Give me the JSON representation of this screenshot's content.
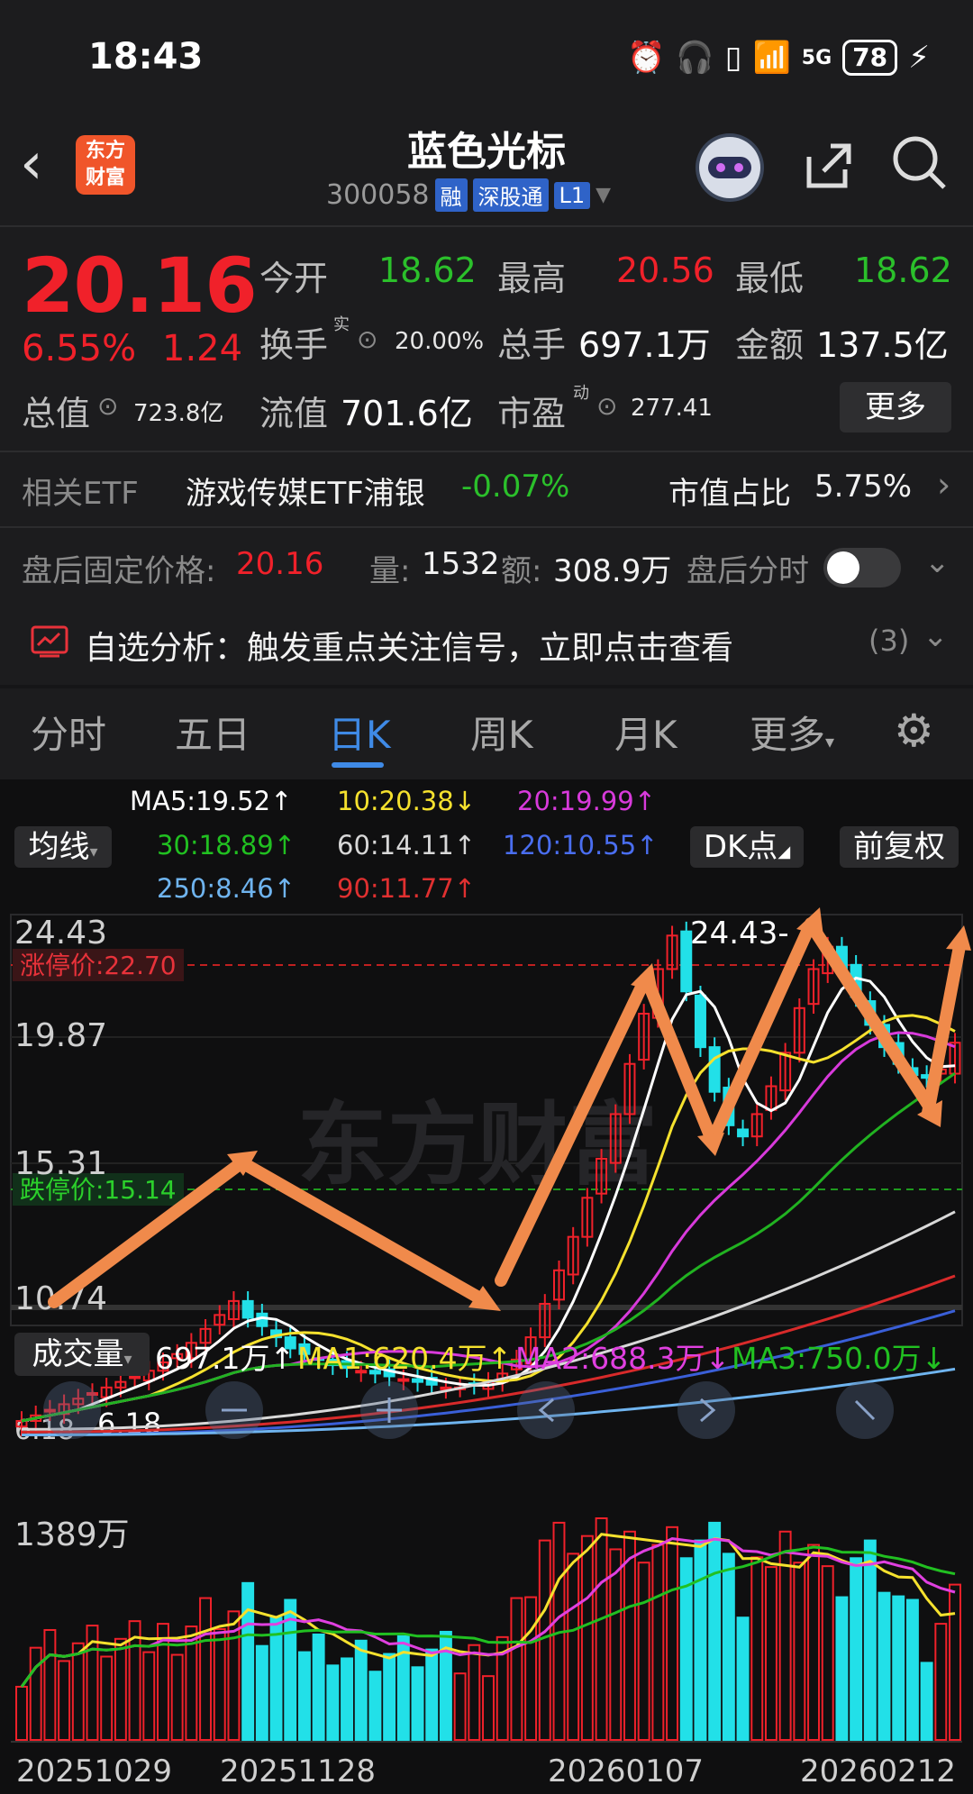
{
  "status_bar": {
    "time": "18:43",
    "network": "5G",
    "battery": "78"
  },
  "header": {
    "logo_text_1": "东方",
    "logo_text_2": "财富",
    "stock_name": "蓝色光标",
    "stock_code": "300058",
    "tags": [
      "融",
      "深股通",
      "L1"
    ]
  },
  "quote": {
    "price": "20.16",
    "change_pct": "6.55%",
    "change": "1.24",
    "open_label": "今开",
    "open": "18.62",
    "high_label": "最高",
    "high": "20.56",
    "low_label": "最低",
    "low": "18.62",
    "turnover_label": "换手",
    "turnover_sup": "实",
    "turnover": "20.00%",
    "volume_label": "总手",
    "volume": "697.1万",
    "amount_label": "金额",
    "amount": "137.5亿",
    "mktcap_label": "总值",
    "mktcap": "723.8亿",
    "float_label": "流值",
    "float_cap": "701.6亿",
    "pe_label": "市盈",
    "pe_sup": "动",
    "pe": "277.41",
    "more_button": "更多"
  },
  "etf": {
    "label": "相关ETF",
    "name": "游戏传媒ETF浦银",
    "change": "-0.07%",
    "weight_label": "市值占比",
    "weight": "5.75%"
  },
  "after_hours": {
    "label": "盘后固定价格:",
    "price": "20.16",
    "vol_label": "量:",
    "vol": "1532",
    "amt_label": "额:",
    "amt": "308.9万",
    "intraday_label": "盘后分时"
  },
  "alert": {
    "text": "自选分析：触发重点关注信号，立即点击查看",
    "count": "(3)"
  },
  "tabs": [
    "分时",
    "五日",
    "日K",
    "周K",
    "月K",
    "更多"
  ],
  "chart_controls": {
    "ma_button": "均线",
    "dk_button": "DK点",
    "adjust_button": "前复权",
    "volume_button": "成交量"
  },
  "ma_legend": {
    "ma5": "MA5:19.52↑",
    "ma10": "10:20.38↓",
    "ma20": "20:19.99↑",
    "ma30": "30:18.89↑",
    "ma60": "60:14.11↑",
    "ma120": "120:10.55↑",
    "ma250": "250:8.46↑",
    "ma90": "90:11.77↑"
  },
  "colors": {
    "up": "#f0212a",
    "down": "#22e0e8",
    "ma5": "#ffffff",
    "ma10": "#f5e12e",
    "ma20": "#d83adb",
    "ma30": "#21b221",
    "ma60": "#d8d8d8",
    "ma90": "#d82a2a",
    "ma120": "#3a5fd8",
    "ma250": "#6fb4ef",
    "accent": "#3f8ae6",
    "arrow": "#f08a4b"
  },
  "price_axis": {
    "ticks": [
      "24.43",
      "19.87",
      "15.31",
      "10.74",
      "6.18"
    ],
    "limit_up": "涨停价:22.70",
    "limit_down": "跌停价:15.14",
    "high_marker": "24.43",
    "low_marker": "6.18"
  },
  "volume": {
    "value": "697.1万↑",
    "ma1": "MA1:620.4万↑",
    "ma2": "MA2:688.3万↓",
    "ma3": "MA3:750.0万↓",
    "max_tick": "1389万"
  },
  "dates": [
    "20251029",
    "20251128",
    "20260107",
    "20260212"
  ],
  "watermark": "东方财富",
  "chart_data": {
    "type": "candlestick",
    "title": "蓝色光标 日K",
    "ylim": [
      6.18,
      24.43
    ],
    "x_labels": [
      "20251029",
      "20251128",
      "20260107",
      "20260212"
    ],
    "close_approx": [
      6.6,
      6.8,
      7.0,
      7.2,
      7.4,
      7.6,
      7.8,
      8.0,
      8.2,
      8.4,
      8.7,
      9.0,
      9.4,
      9.9,
      10.4,
      10.9,
      10.3,
      10.0,
      9.6,
      9.2,
      9.0,
      8.8,
      8.6,
      8.5,
      8.4,
      8.3,
      8.2,
      8.1,
      8.0,
      7.9,
      7.8,
      7.8,
      7.9,
      8.0,
      8.3,
      8.8,
      9.6,
      10.8,
      12.0,
      13.2,
      14.6,
      16.0,
      17.6,
      19.4,
      21.2,
      22.8,
      24.0,
      22.0,
      20.0,
      18.4,
      17.2,
      16.8,
      17.6,
      18.6,
      19.8,
      21.4,
      22.8,
      23.6,
      22.8,
      21.8,
      20.8,
      20.0,
      19.4,
      19.0,
      18.9,
      19.2,
      20.16
    ],
    "volume_max_label": "1389万"
  }
}
